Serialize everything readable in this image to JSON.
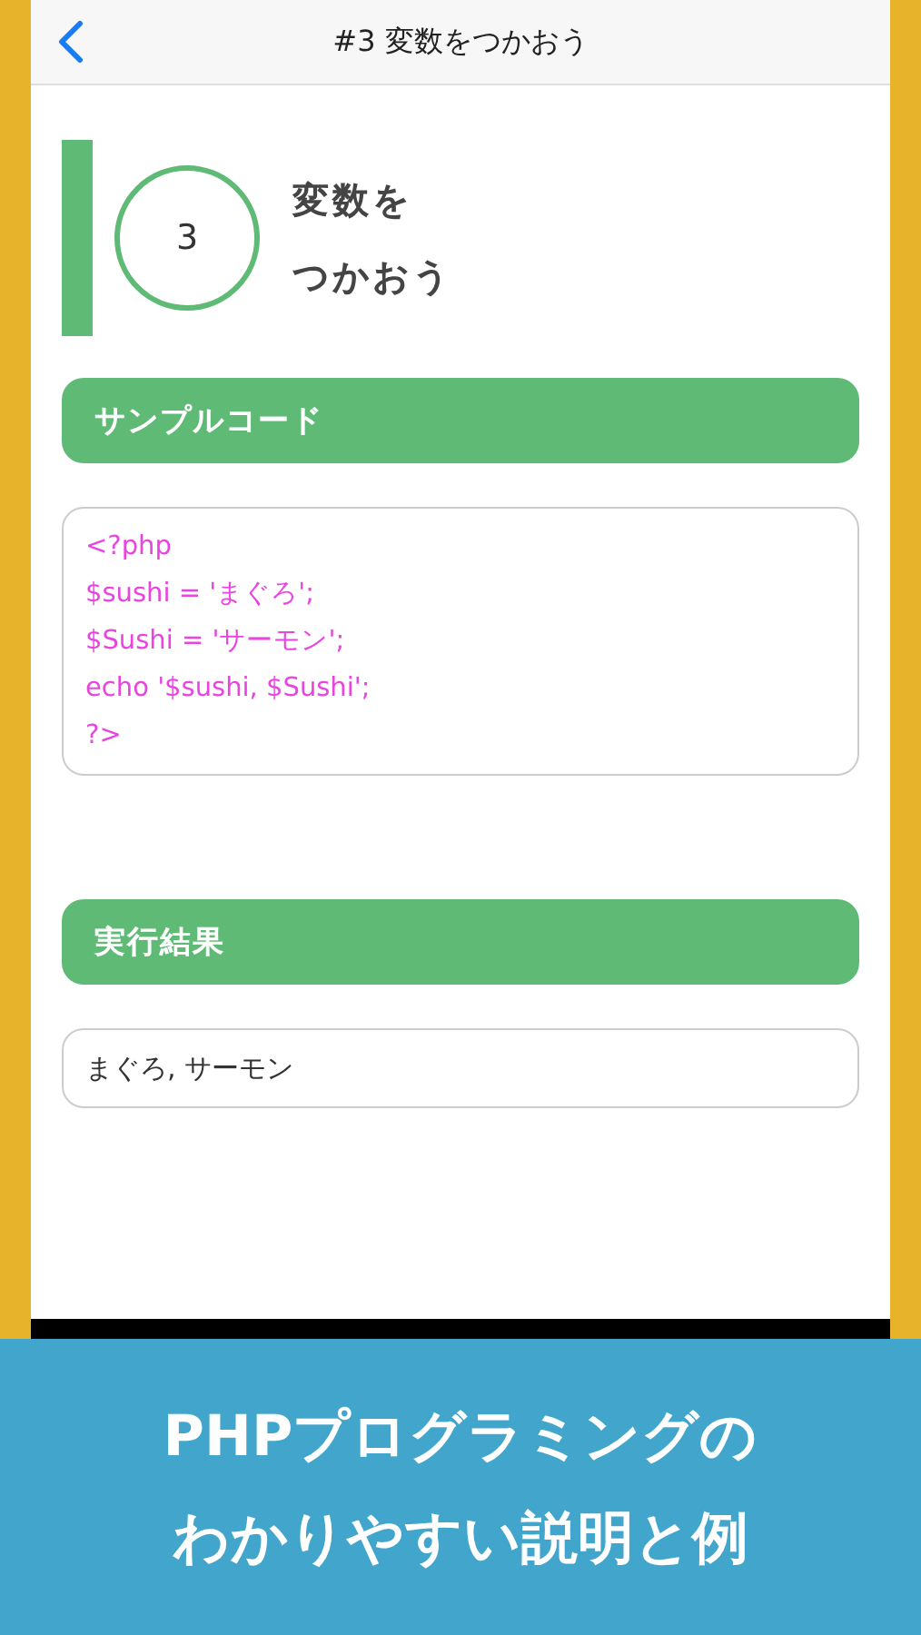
{
  "nav": {
    "title": "#3 変数をつかおう"
  },
  "lesson": {
    "number": "3",
    "title_lines": [
      "変数を",
      "つかおう"
    ]
  },
  "sections": [
    {
      "kind": "code",
      "heading": "サンプルコード",
      "lines": [
        "<?php",
        "$sushi = 'まぐろ';",
        "$Sushi = 'サーモン';",
        "echo '$sushi, $Sushi';",
        "?>"
      ]
    },
    {
      "kind": "output",
      "heading": "実行結果",
      "lines": [
        "まぐろ, サーモン"
      ]
    }
  ],
  "caption": [
    "PHPプログラミングの",
    "わかりやすい説明と例"
  ]
}
